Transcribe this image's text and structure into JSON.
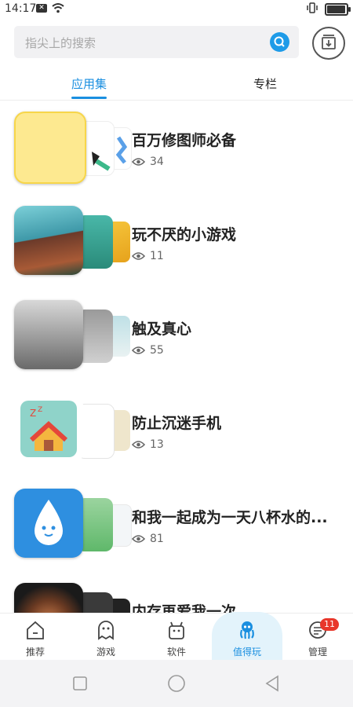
{
  "status": {
    "time": "14:17"
  },
  "search": {
    "placeholder": "指尖上的搜索"
  },
  "tabs": [
    {
      "label": "应用集",
      "active": true
    },
    {
      "label": "专栏",
      "active": false
    }
  ],
  "collections": [
    {
      "title": "百万修图师必备",
      "views": "34"
    },
    {
      "title": "玩不厌的小游戏",
      "views": "11"
    },
    {
      "title": "触及真心",
      "views": "55"
    },
    {
      "title": "防止沉迷手机",
      "views": "13"
    },
    {
      "title": "和我一起成为一天八杯水的...",
      "views": "81"
    },
    {
      "title": "内存再爱我一次",
      "views": ""
    }
  ],
  "nav": [
    {
      "label": "推荐",
      "icon": "home-icon"
    },
    {
      "label": "游戏",
      "icon": "ghost-icon"
    },
    {
      "label": "软件",
      "icon": "android-icon"
    },
    {
      "label": "值得玩",
      "icon": "octopus-icon",
      "active": true
    },
    {
      "label": "管理",
      "icon": "menu-circle-icon",
      "badge": "11"
    }
  ],
  "colors": {
    "accent": "#1a8fe0",
    "badge": "#e8372b"
  }
}
